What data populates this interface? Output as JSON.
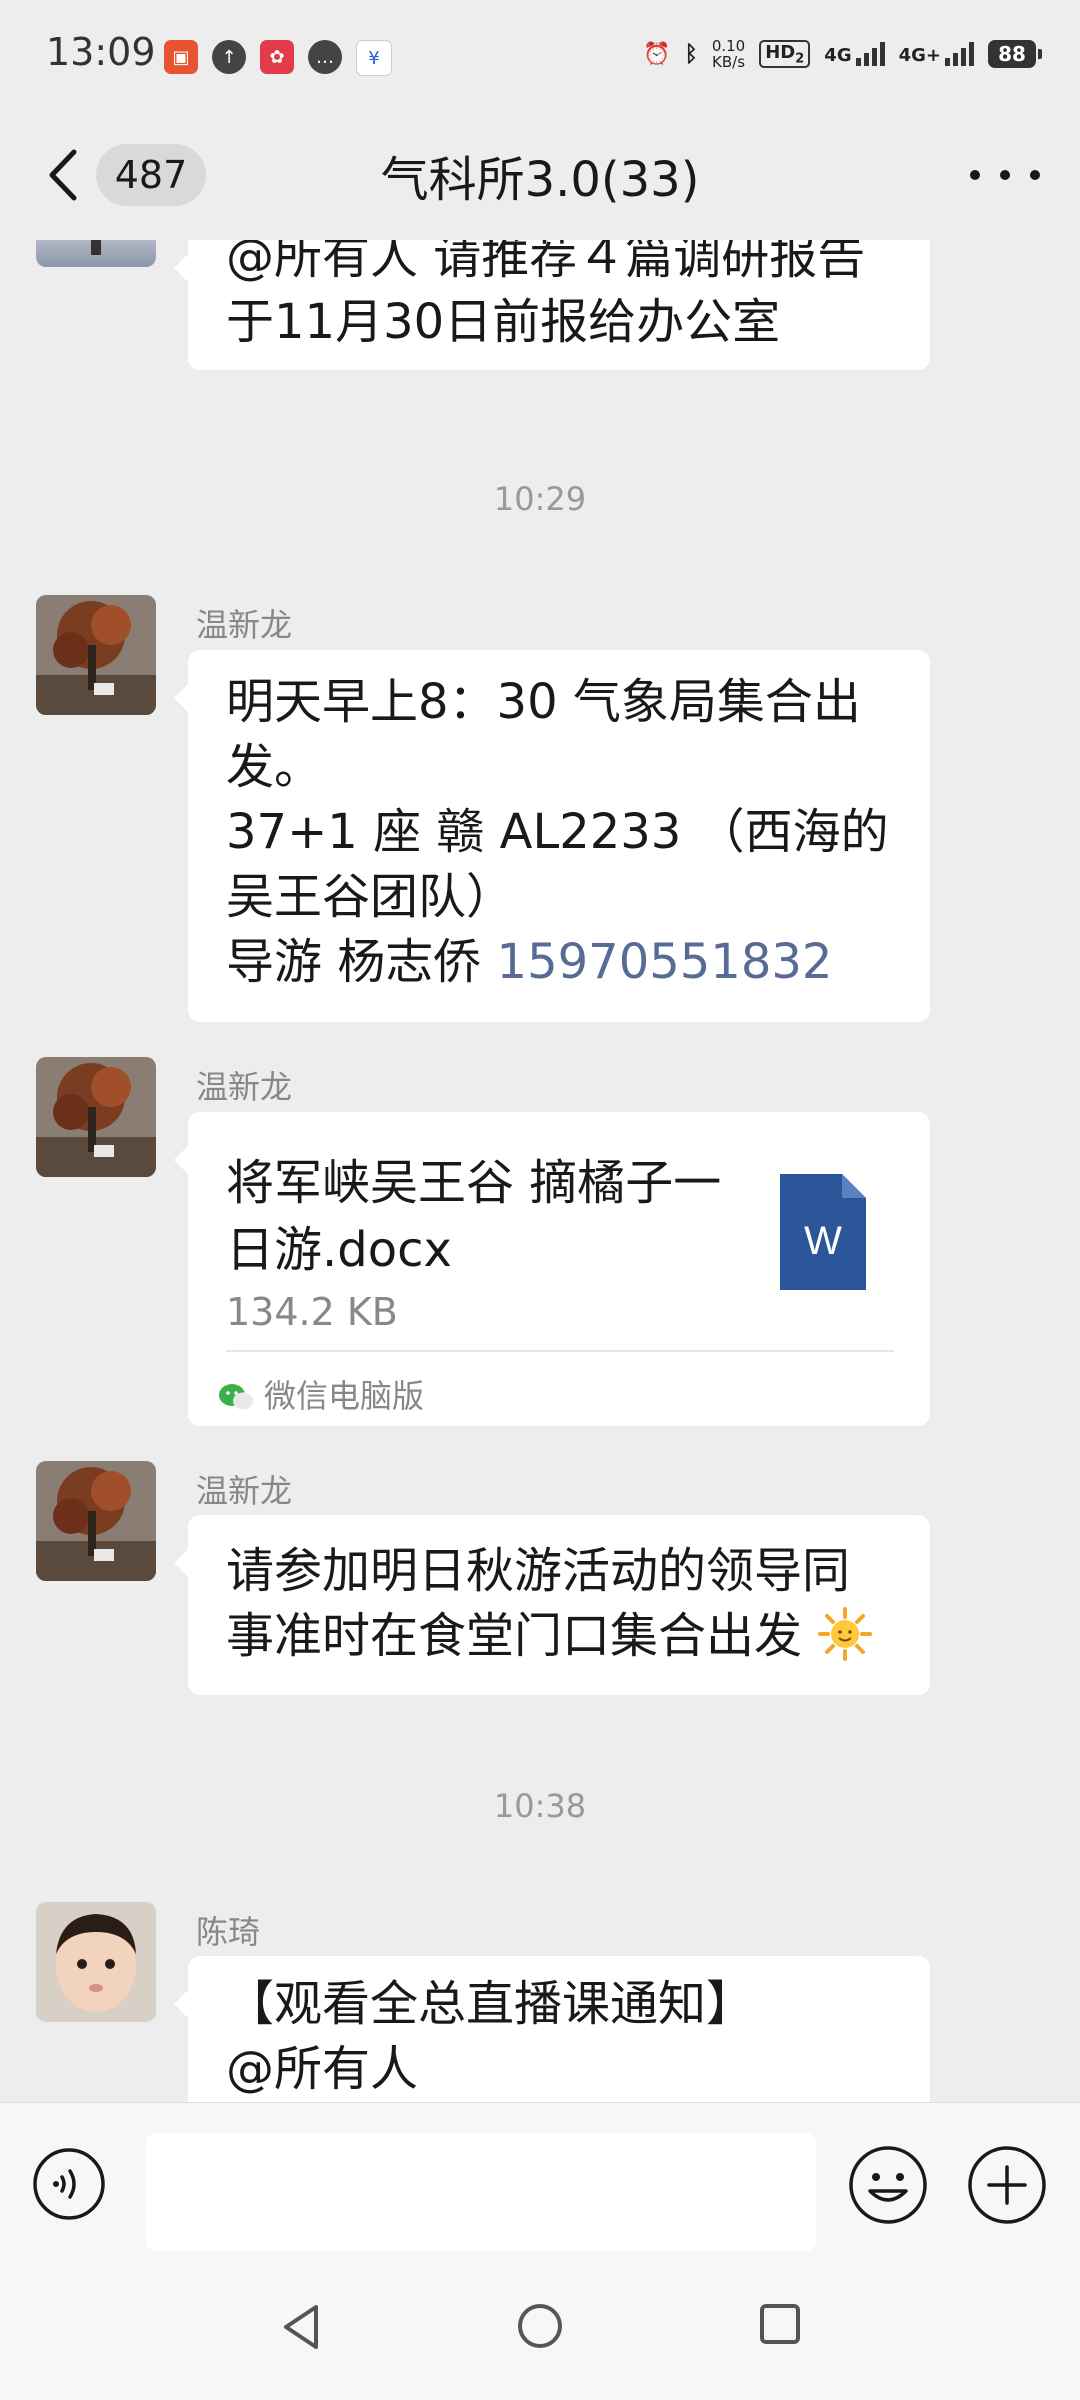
{
  "status_bar": {
    "time": "13:09",
    "net_speed_value": "0.10",
    "net_speed_unit": "KB/s",
    "hd_label": "HD",
    "hd_sub": "2",
    "net1": "4G",
    "net2": "4G+",
    "battery": "88"
  },
  "header": {
    "unread_count": "487",
    "title": "气科所3.0(33)"
  },
  "messages": {
    "m0_text": "@所有人  请推荐４篇调研报告于11月30日前报给办公室",
    "time1": "10:29",
    "m1_sender": "温新龙",
    "m1_line1": "明天早上8：30 气象局集合出发。",
    "m1_line2": "37+1 座 赣 AL2233 （西海的吴王谷团队）",
    "m1_line3_prefix": "导游 杨志侨 ",
    "m1_phone": "15970551832",
    "m2_sender": "温新龙",
    "m2_file_name": "将军峡吴王谷 摘橘子一日游.docx",
    "m2_file_size": "134.2 KB",
    "m2_file_icon_letter": "W",
    "m2_source": "微信电脑版",
    "m3_sender": "温新龙",
    "m3_text": "请参加明日秋游活动的领导同事准时在食堂门口集合出发",
    "time2": "10:38",
    "m4_sender": "陈琦",
    "m4_line1": "【观看全总直播课通知】",
    "m4_line2": "@所有人"
  },
  "colors": {
    "link": "#576b95",
    "word_blue": "#2b579a",
    "background": "#ededed"
  },
  "icons": {
    "back": "chevron-left-icon",
    "more": "more-dots-icon",
    "voice": "voice-icon",
    "emoji": "emoji-icon",
    "plus": "plus-icon",
    "word": "word-doc-icon"
  }
}
